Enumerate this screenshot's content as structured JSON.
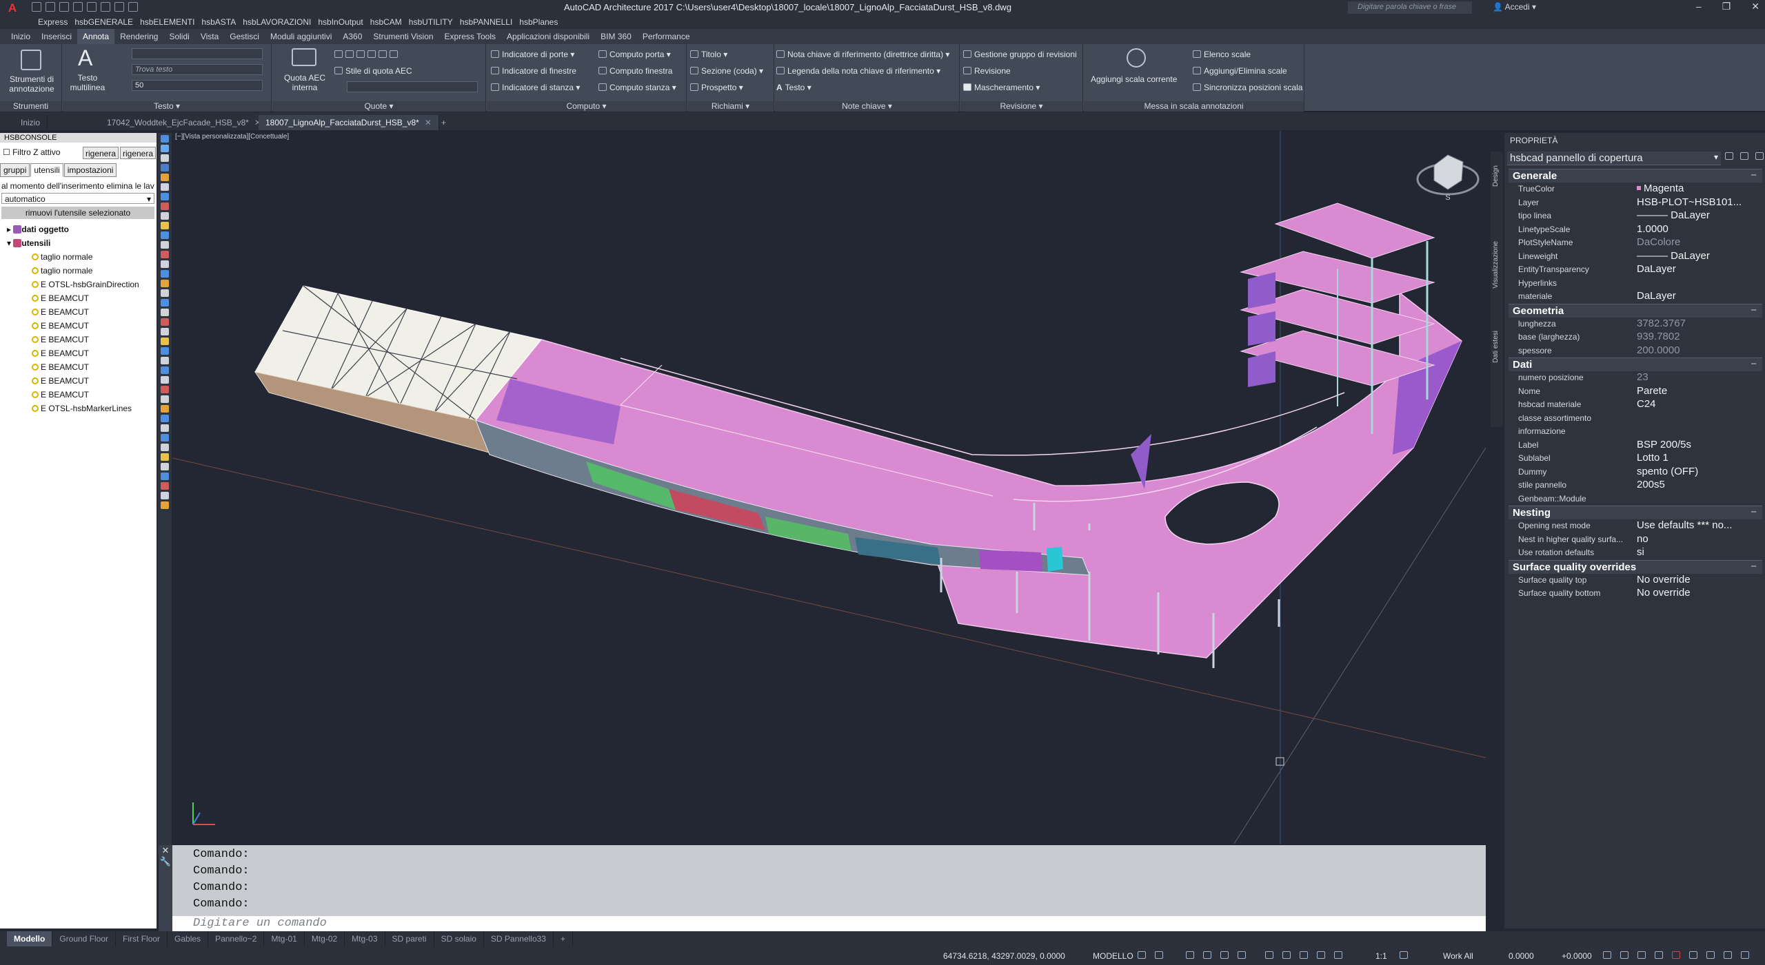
{
  "title_bar": {
    "app_title": "AutoCAD Architecture 2017    C:\\Users\\user4\\Desktop\\18007_locale\\18007_LignoAlp_FacciataDurst_HSB_v8.dwg",
    "search_placeholder": "Digitare parola chiave o frase",
    "login_label": "Accedi"
  },
  "menu_items": [
    "Express",
    "hsbGENERALE",
    "hsbELEMENTI",
    "hsbASTA",
    "hsbLAVORAZIONI",
    "hsbInOutput",
    "hsbCAM",
    "hsbUTILITY",
    "hsbPANNELLI",
    "hsbPlanes"
  ],
  "ribbon_tabs": [
    "Inizio",
    "Inserisci",
    "Annota",
    "Rendering",
    "Solidi",
    "Vista",
    "Gestisci",
    "Moduli aggiuntivi",
    "A360",
    "Strumenti Vision",
    "Express Tools",
    "Applicazioni disponibili",
    "BIM 360",
    "Performance"
  ],
  "ribbon": {
    "strumenti": {
      "btn": "Strumenti di annotazione",
      "footer": "Strumenti"
    },
    "testo": {
      "btn": "Testo multilinea",
      "find_placeholder": "Trova testo",
      "height_value": "50",
      "footer": "Testo"
    },
    "quote": {
      "btn": "Quota AEC interna",
      "style": "Stile di quota AEC",
      "footer": "Quote"
    },
    "computo": {
      "items": [
        "Indicatore di porte",
        "Indicatore di finestre",
        "Indicatore di stanza",
        "Computo porta",
        "Computo finestra",
        "Computo stanza"
      ],
      "footer": "Computo"
    },
    "richiami": {
      "items": [
        "Titolo",
        "Sezione (coda)",
        "Prospetto"
      ],
      "footer": "Richiami"
    },
    "note": {
      "items": [
        "Nota chiave di riferimento (direttrice diritta)",
        "Legenda della nota chiave di riferimento",
        "Testo"
      ],
      "footer": "Note chiave"
    },
    "revisione": {
      "items": [
        "Gestione gruppo di revisioni",
        "Revisione",
        "Mascheramento"
      ],
      "footer": "Revisione"
    },
    "scala": {
      "btn": "Aggiungi scala corrente",
      "items": [
        "Elenco scale",
        "Aggiungi/Elimina scale",
        "Sincronizza posizioni scala"
      ],
      "footer": "Messa in scala annotazioni"
    }
  },
  "doc_tabs": [
    "Inizio",
    "17042_Woddtek_EjcFacade_HSB_v8*",
    "18007_LignoAlp_FacciataDurst_HSB_v8*"
  ],
  "left_panel": {
    "header": "HSBCONSOLE",
    "filter_label": "Filtro Z attivo",
    "regen1": "rigenera",
    "regen2": "rigenera",
    "tabs": [
      "gruppi",
      "utensili",
      "impostazioni"
    ],
    "insert_msg": "al momento dell'inserimento elimina le lav",
    "mode_value": "automatico",
    "remove_btn": "rimuovi l'utensile selezionato",
    "tree_root1": "dati oggetto",
    "tree_root2": "utensili",
    "tree_items": [
      "taglio normale",
      "taglio normale",
      "E OTSL-hsbGrainDirection",
      "E BEAMCUT",
      "E BEAMCUT",
      "E BEAMCUT",
      "E BEAMCUT",
      "E BEAMCUT",
      "E BEAMCUT",
      "E BEAMCUT",
      "E BEAMCUT",
      "E OTSL-hsbMarkerLines"
    ]
  },
  "viewport": {
    "label": "[−][Vista personalizzata][Concettuale]"
  },
  "command": {
    "lines": [
      "Comando:",
      "Comando:",
      "Comando:",
      "Comando:"
    ],
    "placeholder": "Digitare un comando"
  },
  "layout_tabs": [
    "Modello",
    "Ground Floor",
    "First Floor",
    "Gables",
    "Pannello~2",
    "Mtg-01",
    "Mtg-02",
    "Mtg-03",
    "SD pareti",
    "SD solaio",
    "SD Pannello33"
  ],
  "status": {
    "coords": "64734.6218, 43297.0029, 0.0000",
    "mode": "MODELLO",
    "scale": "1:1",
    "workspace": "Work All",
    "value": "0.0000",
    "value2": "+0.0000"
  },
  "properties": {
    "title": "PROPRIETÀ",
    "selected": "hsbcad pannello di copertura",
    "side_tabs": [
      "Design",
      "Visualizzazione",
      "Dati estesi"
    ],
    "groups": [
      {
        "name": "Generale",
        "rows": [
          {
            "k": "TrueColor",
            "v": "Magenta"
          },
          {
            "k": "Layer",
            "v": "HSB-PLOT~HSB101..."
          },
          {
            "k": "tipo linea",
            "v": "——— DaLayer"
          },
          {
            "k": "LinetypeScale",
            "v": "1.0000"
          },
          {
            "k": "PlotStyleName",
            "v": "DaColore"
          },
          {
            "k": "Lineweight",
            "v": "——— DaLayer"
          },
          {
            "k": "EntityTransparency",
            "v": "DaLayer"
          },
          {
            "k": "Hyperlinks",
            "v": ""
          },
          {
            "k": "materiale",
            "v": "DaLayer"
          }
        ]
      },
      {
        "name": "Geometria",
        "rows": [
          {
            "k": "lunghezza",
            "v": "3782.3767"
          },
          {
            "k": "base (larghezza)",
            "v": "939.7802"
          },
          {
            "k": "spessore",
            "v": "200.0000"
          }
        ]
      },
      {
        "name": "Dati",
        "rows": [
          {
            "k": "numero posizione",
            "v": "23"
          },
          {
            "k": "Nome",
            "v": "Parete"
          },
          {
            "k": "hsbcad materiale",
            "v": "C24"
          },
          {
            "k": "classe assortimento",
            "v": ""
          },
          {
            "k": "informazione",
            "v": ""
          },
          {
            "k": "Label",
            "v": "BSP 200/5s"
          },
          {
            "k": "Sublabel",
            "v": "Lotto 1"
          },
          {
            "k": "Dummy",
            "v": "spento (OFF)"
          },
          {
            "k": "stile pannello",
            "v": "200s5"
          },
          {
            "k": "Genbeam::Module",
            "v": ""
          }
        ]
      },
      {
        "name": "Nesting",
        "rows": [
          {
            "k": "Opening nest mode",
            "v": "Use defaults *** no..."
          },
          {
            "k": "Nest in higher quality surfa...",
            "v": "no"
          },
          {
            "k": "Use rotation defaults",
            "v": "si"
          }
        ]
      },
      {
        "name": "Surface quality overrides",
        "rows": [
          {
            "k": "Surface quality top",
            "v": "No override"
          },
          {
            "k": "Surface quality bottom",
            "v": "No override"
          }
        ]
      }
    ]
  },
  "colors": {
    "accent_magenta": "#d98ad0",
    "viewport_bg": "#222733",
    "panel_bg": "#2e333d"
  }
}
